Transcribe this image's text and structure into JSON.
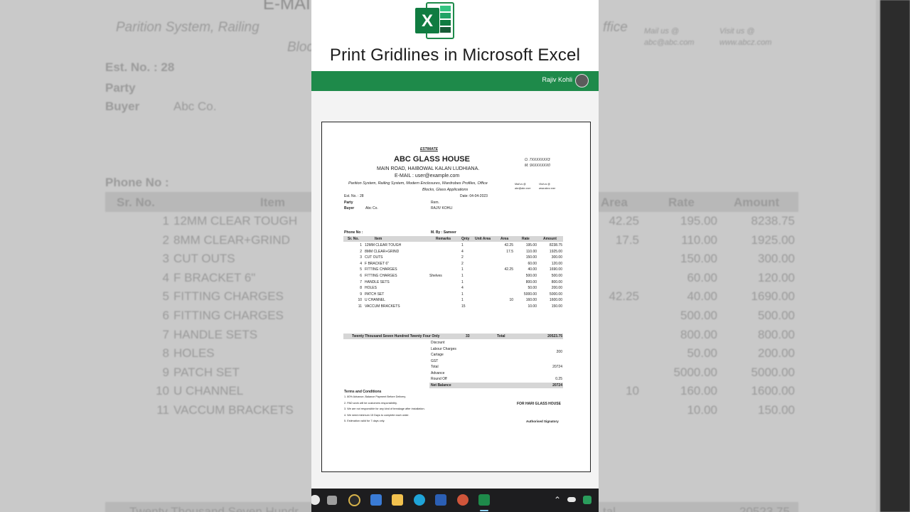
{
  "video": {
    "title": "Print Gridlines in Microsoft Excel",
    "author": "Rajiv Kohli",
    "logo_letter": "X"
  },
  "background": {
    "top_fragment": "E-MAI",
    "subtitle_left": "Parition System, Railing",
    "subtitle_right": "ffice",
    "blocks": "Block",
    "est_no": "Est. No. : 28",
    "party": "Party",
    "buyer": "Buyer",
    "buyer_value": "Abc Co.",
    "mail": "Mail us @",
    "mail_value": "abc@abc.com",
    "visit": "Visit us @",
    "visit_value": "www.abcz.com",
    "phone": "Phone No :",
    "col_srno": "Sr. No.",
    "col_item": "Item",
    "col_area": "Area",
    "col_rate": "Rate",
    "col_amount": "Amount",
    "footer_left": "Twenty Thousand Seven Hundr",
    "footer_mid": "tal",
    "footer_right": "20523.75"
  },
  "doc": {
    "estimate_label": "ESTIMATE",
    "company": "ABC GLASS HOUSE",
    "address": "MAIN ROAD, HAIBOWAL KALAN LUDHIANA.",
    "email": "E-MAIL : user@example.com",
    "description_line1": "Parition System, Railing System, Modern Enclosures, Wardrobes Profiles, Office",
    "description_line2": "Blocks, Glass Applications",
    "phone_o": "O. 7XXXXXXX3",
    "phone_m": "M. 9XXXXXXX0",
    "mail_label": "Mail us @",
    "mail_value": "abc@abc.com",
    "visit_label": "Visit us @",
    "visit_value": "www.abcz.com",
    "est_no": "Est. No. : 28",
    "date": "Date: 04-04-2023",
    "party_label": "Party",
    "ref_label": "Rem.",
    "buyer_label": "Buyer",
    "buyer_value": "Abc Co.",
    "ref_value": "RAJIV KOHLI",
    "phone_label": "Phone No :",
    "m_by": "M. By : Sameer",
    "headers": [
      "Sr. No.",
      "Item",
      "Remarks",
      "Qnty",
      "Unit Area",
      "Area",
      "Rate",
      "Amount"
    ],
    "rows": [
      {
        "no": "1",
        "item": "12MM CLEAR TOUGH",
        "remarks": "",
        "qty": "1",
        "area": "42.25",
        "rate": "195.00",
        "amount": "8238.75"
      },
      {
        "no": "2",
        "item": "8MM CLEAR+GRIND",
        "remarks": "",
        "qty": "4",
        "area": "17.5",
        "rate": "110.00",
        "amount": "1925.00"
      },
      {
        "no": "3",
        "item": "CUT OUTS",
        "remarks": "",
        "qty": "2",
        "area": "",
        "rate": "150.00",
        "amount": "300.00"
      },
      {
        "no": "4",
        "item": "F BRACKET 6\"",
        "remarks": "",
        "qty": "2",
        "area": "",
        "rate": "60.00",
        "amount": "120.00"
      },
      {
        "no": "5",
        "item": "FITTING CHARGES",
        "remarks": "",
        "qty": "1",
        "area": "42.25",
        "rate": "40.00",
        "amount": "1690.00"
      },
      {
        "no": "6",
        "item": "FITTING CHARGES",
        "remarks": "Shelves",
        "qty": "1",
        "area": "",
        "rate": "500.00",
        "amount": "500.00"
      },
      {
        "no": "7",
        "item": "HANDLE SETS",
        "remarks": "",
        "qty": "1",
        "area": "",
        "rate": "800.00",
        "amount": "800.00"
      },
      {
        "no": "8",
        "item": "HOLES",
        "remarks": "",
        "qty": "4",
        "area": "",
        "rate": "50.00",
        "amount": "200.00"
      },
      {
        "no": "9",
        "item": "PATCH SET",
        "remarks": "",
        "qty": "1",
        "area": "",
        "rate": "5000.00",
        "amount": "5000.00"
      },
      {
        "no": "10",
        "item": "U CHANNEL",
        "remarks": "",
        "qty": "1",
        "area": "10",
        "rate": "160.00",
        "amount": "1600.00"
      },
      {
        "no": "11",
        "item": "VACCUM BRACKETS",
        "remarks": "",
        "qty": "15",
        "area": "",
        "rate": "10.00",
        "amount": "150.00"
      }
    ],
    "amount_words": "Twenty Thousand Seven Hundred Twenty Four Only",
    "total_qty": "33",
    "total_label": "Total",
    "total_value": "20523.75",
    "charges": [
      {
        "label": "Discount",
        "value": ""
      },
      {
        "label": "Labour Charges",
        "value": "200"
      },
      {
        "label": "Cartage",
        "value": ""
      },
      {
        "label": "GST",
        "value": ""
      },
      {
        "label": "Total",
        "value": "20724"
      },
      {
        "label": "Advance",
        "value": ""
      },
      {
        "label": "Round Off",
        "value": "0.25"
      }
    ],
    "net_balance_label": "Net Balance",
    "net_balance_value": "20724",
    "terms_title": "Terms and Conditions",
    "terms": [
      "1. 80% Advance, Balance Payment Before Delivery.",
      "2. PAD work will be customers responsibility.",
      "3. We are not responsible for any kind of breakage after installation.",
      "4. We need minimum 15 Days to complete each order.",
      "5. Estimation valid for 7 days only."
    ],
    "for_company": "FOR HARI GLASS HOUSE",
    "signatory": "Authorised Signatory"
  },
  "taskbar": {
    "icons": [
      "search-icon",
      "task-view-icon",
      "media-player-icon",
      "store-icon",
      "file-explorer-icon",
      "edge-icon",
      "word-icon",
      "powerpoint-icon",
      "excel-icon",
      "chevron-up-icon",
      "onedrive-icon",
      "defender-icon"
    ]
  },
  "colors": {
    "excel_green": "#1e8a4a",
    "dark_green": "#185c37",
    "taskbar": "#1d1d1f"
  }
}
